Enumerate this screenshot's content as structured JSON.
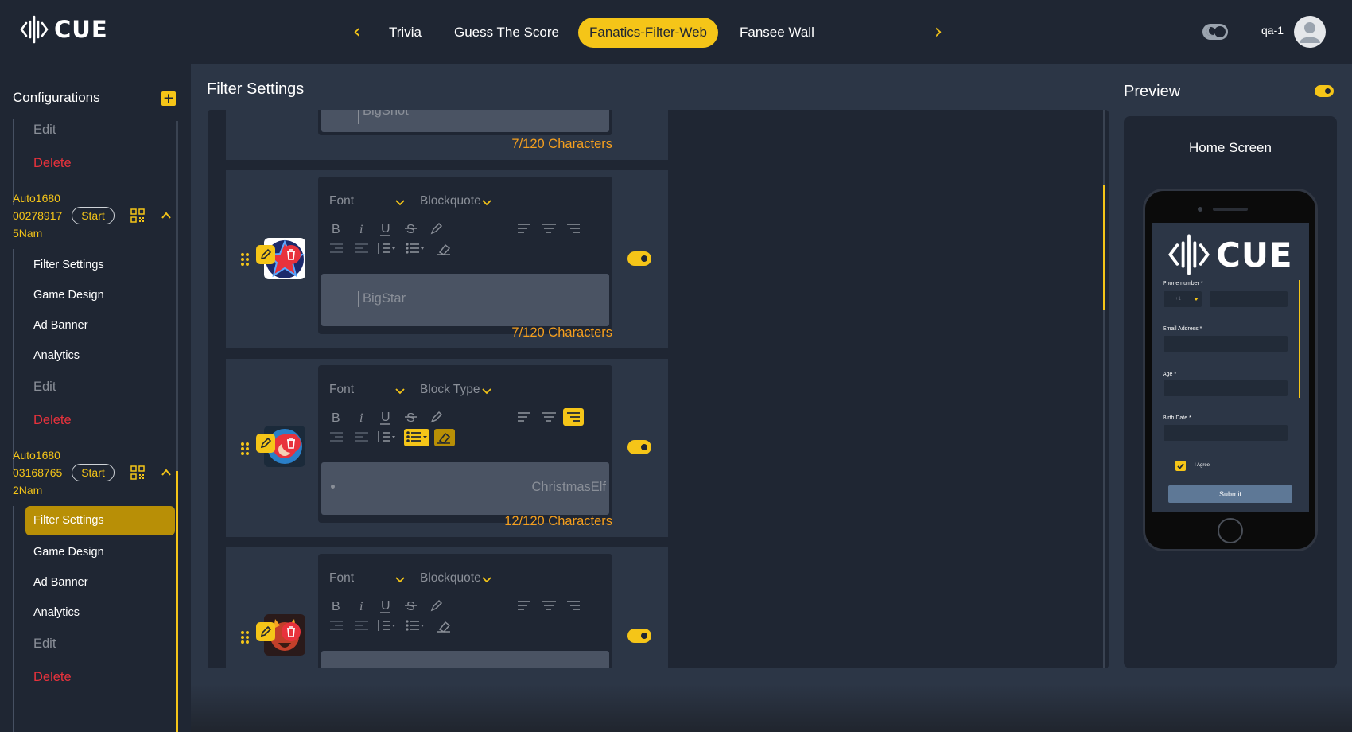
{
  "app": {
    "logo_text": "CUE"
  },
  "topnav": {
    "tabs": [
      {
        "label": "Trivia"
      },
      {
        "label": "Guess The Score"
      },
      {
        "label": "Fanatics-Filter-Web",
        "active": true
      },
      {
        "label": "Fansee Wall"
      }
    ]
  },
  "user": {
    "name": "qa-1"
  },
  "sidebar": {
    "title": "Configurations",
    "top_items": [
      {
        "label": "Edit"
      },
      {
        "label": "Delete"
      }
    ],
    "games": [
      {
        "name_lines": [
          "Auto1680",
          "00278917",
          "5Nam"
        ],
        "start_label": "Start",
        "items": [
          {
            "label": "Filter Settings"
          },
          {
            "label": "Game Design"
          },
          {
            "label": "Ad Banner"
          },
          {
            "label": "Analytics"
          },
          {
            "label": "Edit"
          },
          {
            "label": "Delete"
          }
        ]
      },
      {
        "name_lines": [
          "Auto1680",
          "03168765",
          "2Nam"
        ],
        "start_label": "Start",
        "items": [
          {
            "label": "Filter Settings",
            "active": true
          },
          {
            "label": "Game Design"
          },
          {
            "label": "Ad Banner"
          },
          {
            "label": "Analytics"
          },
          {
            "label": "Edit"
          },
          {
            "label": "Delete"
          }
        ]
      }
    ]
  },
  "main": {
    "title": "Filter Settings",
    "filters": [
      {
        "text": "BigShot",
        "char_count": "7/120 Characters"
      },
      {
        "font_label": "Font",
        "block_label": "Blockquote",
        "text": "BigStar",
        "char_count": "7/120 Characters",
        "enabled": true
      },
      {
        "font_label": "Font",
        "block_label": "Block Type",
        "text": "ChristmasElf",
        "char_count": "12/120 Characters",
        "enabled": true
      },
      {
        "font_label": "Font",
        "block_label": "Blockquote",
        "text": "",
        "enabled": true
      }
    ]
  },
  "preview": {
    "title": "Preview",
    "screen_label": "Home Screen",
    "form": {
      "logo_text": "CUE",
      "phone_label": "Phone number *",
      "country_code": "+1",
      "email_label": "Email Address *",
      "age_label": "Age *",
      "birth_label": "Birth Date *",
      "agree_label": "I Agree",
      "submit_label": "Submit"
    }
  },
  "colors": {
    "accent": "#f5c518",
    "danger": "#e8323c",
    "count": "#f59f1e",
    "bg": "#1f2633",
    "panel": "#2c3646"
  }
}
